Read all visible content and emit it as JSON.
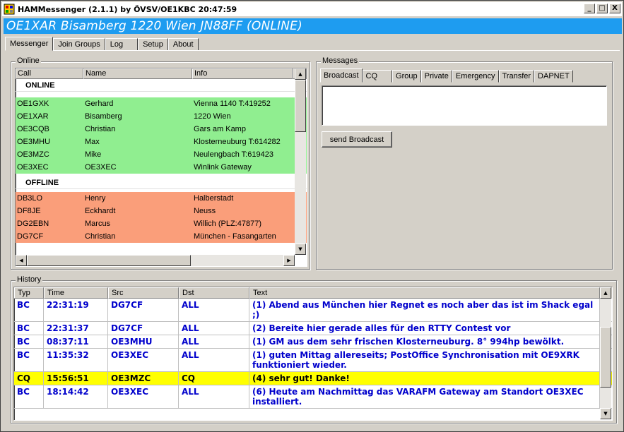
{
  "window": {
    "title": "HAMMessenger (2.1.1) by ÖVSV/OE1KBC 20:47:59",
    "buttons": {
      "minimize": "_",
      "maximize": "□",
      "close": "X"
    }
  },
  "banner": {
    "text": "OE1XAR Bisamberg 1220 Wien JN88FF (ONLINE)"
  },
  "main_tabs": [
    "Messenger",
    "Join Groups",
    "Log",
    "Setup",
    "About"
  ],
  "online_panel": {
    "legend": "Online",
    "columns": [
      "Call",
      "Name",
      "Info",
      ""
    ],
    "online_title": "ONLINE",
    "offline_title": "OFFLINE",
    "online_users": [
      {
        "call": "OE1GXK",
        "name": "Gerhard",
        "info": "Vienna 1140 T:419252",
        "extra": "..."
      },
      {
        "call": "OE1XAR",
        "name": "Bisamberg",
        "info": "1220 Wien",
        "extra": "..."
      },
      {
        "call": "OE3CQB",
        "name": "Christian",
        "info": "Gars am Kamp",
        "extra": "..."
      },
      {
        "call": "OE3MHU",
        "name": "Max",
        "info": "Klosterneuburg T:614282",
        "extra": "..."
      },
      {
        "call": "OE3MZC",
        "name": "Mike",
        "info": "Neulengbach T:619423",
        "extra": "..."
      },
      {
        "call": "OE3XEC",
        "name": "OE3XEC",
        "info": "Winlink Gateway",
        "extra": "..."
      }
    ],
    "offline_users": [
      {
        "call": "DB3LO",
        "name": "Henry",
        "info": "Halberstadt",
        "extra": "..."
      },
      {
        "call": "DF8JE",
        "name": "Eckhardt",
        "info": "Neuss",
        "extra": "..."
      },
      {
        "call": "DG2EBN",
        "name": "Marcus",
        "info": "Willich (PLZ:47877)",
        "extra": "..."
      },
      {
        "call": "DG7CF",
        "name": "Christian",
        "info": "München - Fasangarten",
        "extra": "..."
      }
    ]
  },
  "messages_panel": {
    "legend": "Messages",
    "tabs": [
      "Broadcast",
      "CQ",
      "Group",
      "Private",
      "Emergency",
      "Transfer",
      "DAPNET"
    ],
    "message_text": "",
    "send_button": "send Broadcast"
  },
  "history_panel": {
    "legend": "History",
    "columns": [
      "Typ",
      "Time",
      "Src",
      "Dst",
      "Text"
    ],
    "rows": [
      {
        "typ": "BC",
        "time": "22:31:19",
        "src": "DG7CF",
        "dst": "ALL",
        "text": "(1) Abend aus München hier Regnet es noch aber das ist im Shack egal ;)"
      },
      {
        "typ": "BC",
        "time": "22:31:37",
        "src": "DG7CF",
        "dst": "ALL",
        "text": "(2) Bereite hier gerade alles für den RTTY Contest vor"
      },
      {
        "typ": "BC",
        "time": "08:37:11",
        "src": "OE3MHU",
        "dst": "ALL",
        "text": "(1) GM aus dem sehr frischen Klosterneuburg. 8° 994hp bewölkt."
      },
      {
        "typ": "BC",
        "time": "11:35:32",
        "src": "OE3XEC",
        "dst": "ALL",
        "text": "(1) guten Mittag allereseits; PostOffice Synchronisation mit OE9XRK funktioniert wieder."
      },
      {
        "typ": "CQ",
        "time": "15:56:51",
        "src": "OE3MZC",
        "dst": "CQ",
        "text": "(4) sehr gut! Danke!"
      },
      {
        "typ": "BC",
        "time": "18:14:42",
        "src": "OE3XEC",
        "dst": "ALL",
        "text": "(6) Heute am Nachmittag das VARAFM Gateway am Standort OE3XEC installiert."
      }
    ]
  },
  "colors": {
    "banner": "#1e9cf0",
    "online_row": "#90ee90",
    "offline_row": "#fa9e7a",
    "history_text": "#0000cc",
    "cq_highlight": "#ffff00"
  }
}
